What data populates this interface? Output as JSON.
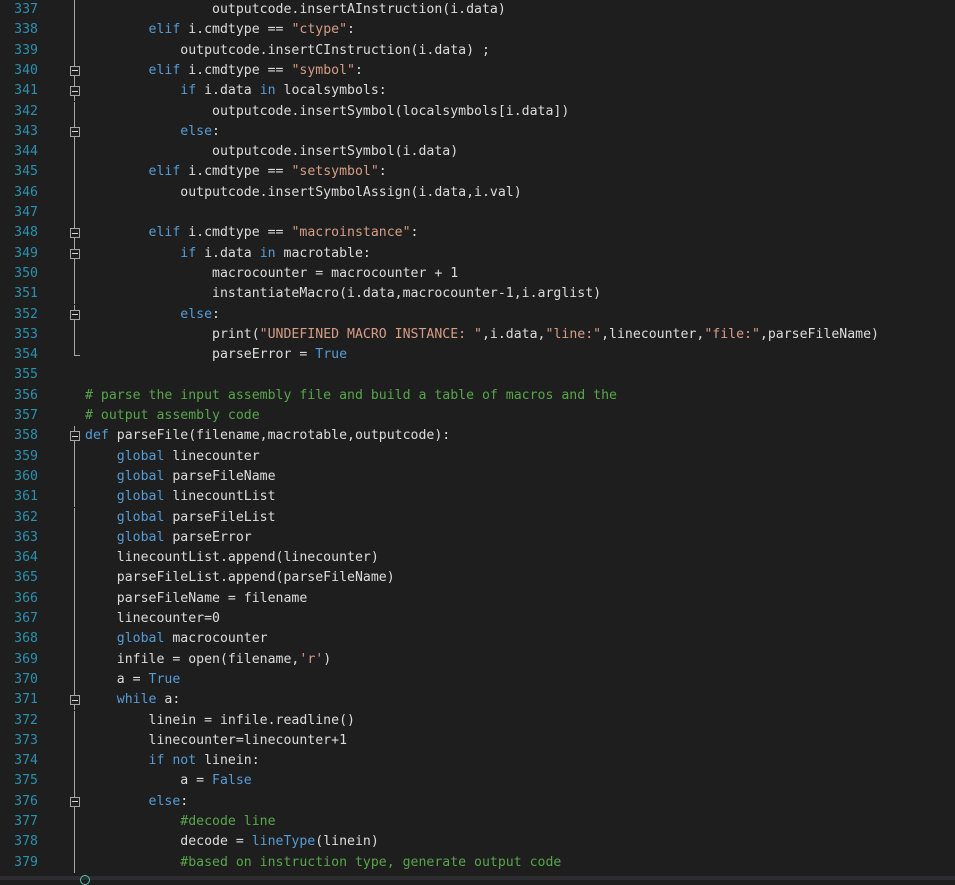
{
  "editor": {
    "colors": {
      "background": "#1e1e1e",
      "line_number": "#2b91af",
      "keyword": "#569cd6",
      "string": "#d69d85",
      "comment": "#57a64a",
      "default": "#dcdcdc"
    },
    "lines": [
      {
        "n": "337",
        "segs": [
          [
            "",
            "                outputcode.insertAInstruction(i.data)"
          ]
        ]
      },
      {
        "n": "338",
        "segs": [
          [
            "kw",
            "        elif"
          ],
          [
            "",
            " i.cmdtype == "
          ],
          [
            "str",
            "\"ctype\""
          ],
          [
            "",
            ":"
          ]
        ]
      },
      {
        "n": "339",
        "segs": [
          [
            "",
            "            outputcode.insertCInstruction(i.data) ;"
          ]
        ]
      },
      {
        "n": "340",
        "segs": [
          [
            "kw",
            "        elif"
          ],
          [
            "",
            " i.cmdtype == "
          ],
          [
            "str",
            "\"symbol\""
          ],
          [
            "",
            ":"
          ]
        ]
      },
      {
        "n": "341",
        "segs": [
          [
            "kw",
            "            if"
          ],
          [
            "",
            " i.data "
          ],
          [
            "kw",
            "in"
          ],
          [
            "",
            " localsymbols:"
          ]
        ]
      },
      {
        "n": "342",
        "segs": [
          [
            "",
            "                outputcode.insertSymbol(localsymbols[i.data])"
          ]
        ]
      },
      {
        "n": "343",
        "segs": [
          [
            "kw",
            "            else"
          ],
          [
            "",
            ":"
          ]
        ]
      },
      {
        "n": "344",
        "segs": [
          [
            "",
            "                outputcode.insertSymbol(i.data)"
          ]
        ]
      },
      {
        "n": "345",
        "segs": [
          [
            "kw",
            "        elif"
          ],
          [
            "",
            " i.cmdtype == "
          ],
          [
            "str",
            "\"setsymbol\""
          ],
          [
            "",
            ":"
          ]
        ]
      },
      {
        "n": "346",
        "segs": [
          [
            "",
            "            outputcode.insertSymbolAssign(i.data,i.val)"
          ]
        ]
      },
      {
        "n": "347",
        "segs": []
      },
      {
        "n": "348",
        "segs": [
          [
            "kw",
            "        elif"
          ],
          [
            "",
            " i.cmdtype == "
          ],
          [
            "str",
            "\"macroinstance\""
          ],
          [
            "",
            ":"
          ]
        ]
      },
      {
        "n": "349",
        "segs": [
          [
            "kw",
            "            if"
          ],
          [
            "",
            " i.data "
          ],
          [
            "kw",
            "in"
          ],
          [
            "",
            " macrotable:"
          ]
        ]
      },
      {
        "n": "350",
        "segs": [
          [
            "",
            "                macrocounter = macrocounter + 1"
          ]
        ]
      },
      {
        "n": "351",
        "segs": [
          [
            "",
            "                instantiateMacro(i.data,macrocounter-1,i.arglist)"
          ]
        ]
      },
      {
        "n": "352",
        "segs": [
          [
            "kw",
            "            else"
          ],
          [
            "",
            ":"
          ]
        ]
      },
      {
        "n": "353",
        "segs": [
          [
            "",
            "                print("
          ],
          [
            "str",
            "\"UNDEFINED MACRO INSTANCE: \""
          ],
          [
            "",
            ",i.data,"
          ],
          [
            "str",
            "\"line:\""
          ],
          [
            "",
            ",linecounter,"
          ],
          [
            "str",
            "\"file:\""
          ],
          [
            "",
            ",parseFileName)"
          ]
        ]
      },
      {
        "n": "354",
        "segs": [
          [
            "",
            "                parseError = "
          ],
          [
            "kw",
            "True"
          ]
        ]
      },
      {
        "n": "355",
        "segs": []
      },
      {
        "n": "356",
        "segs": [
          [
            "cm",
            "# parse the input assembly file and build a table of macros and the"
          ]
        ]
      },
      {
        "n": "357",
        "segs": [
          [
            "cm",
            "# output assembly code"
          ]
        ]
      },
      {
        "n": "358",
        "segs": [
          [
            "kw",
            "def"
          ],
          [
            "",
            " parseFile(filename,macrotable,outputcode):"
          ]
        ]
      },
      {
        "n": "359",
        "segs": [
          [
            "kw",
            "    global"
          ],
          [
            "",
            " linecounter"
          ]
        ]
      },
      {
        "n": "360",
        "segs": [
          [
            "kw",
            "    global"
          ],
          [
            "",
            " parseFileName"
          ]
        ]
      },
      {
        "n": "361",
        "segs": [
          [
            "kw",
            "    global"
          ],
          [
            "",
            " linecountList"
          ]
        ]
      },
      {
        "n": "362",
        "segs": [
          [
            "kw",
            "    global"
          ],
          [
            "",
            " parseFileList"
          ]
        ]
      },
      {
        "n": "363",
        "segs": [
          [
            "kw",
            "    global"
          ],
          [
            "",
            " parseError"
          ]
        ]
      },
      {
        "n": "364",
        "segs": [
          [
            "",
            "    linecountList.append(linecounter)"
          ]
        ]
      },
      {
        "n": "365",
        "segs": [
          [
            "",
            "    parseFileList.append(parseFileName)"
          ]
        ]
      },
      {
        "n": "366",
        "segs": [
          [
            "",
            "    parseFileName = filename"
          ]
        ]
      },
      {
        "n": "367",
        "segs": [
          [
            "",
            "    linecounter=0"
          ]
        ]
      },
      {
        "n": "368",
        "segs": [
          [
            "kw",
            "    global"
          ],
          [
            "",
            " macrocounter"
          ]
        ]
      },
      {
        "n": "369",
        "segs": [
          [
            "",
            "    infile = open(filename,"
          ],
          [
            "str",
            "'r'"
          ],
          [
            "",
            ")"
          ]
        ]
      },
      {
        "n": "370",
        "segs": [
          [
            "",
            "    a = "
          ],
          [
            "kw",
            "True"
          ]
        ]
      },
      {
        "n": "371",
        "segs": [
          [
            "kw",
            "    while"
          ],
          [
            "",
            " a:"
          ]
        ]
      },
      {
        "n": "372",
        "segs": [
          [
            "",
            "        linein = infile.readline()"
          ]
        ]
      },
      {
        "n": "373",
        "segs": [
          [
            "",
            "        linecounter=linecounter+1"
          ]
        ]
      },
      {
        "n": "374",
        "segs": [
          [
            "kw",
            "        if not"
          ],
          [
            "",
            " linein:"
          ]
        ]
      },
      {
        "n": "375",
        "segs": [
          [
            "",
            "            a = "
          ],
          [
            "kw",
            "False"
          ]
        ]
      },
      {
        "n": "376",
        "segs": [
          [
            "kw",
            "        else"
          ],
          [
            "",
            ":"
          ]
        ]
      },
      {
        "n": "377",
        "segs": [
          [
            "cm",
            "            #decode line"
          ]
        ]
      },
      {
        "n": "378",
        "segs": [
          [
            "",
            "            decode = "
          ],
          [
            "kw",
            "lineType"
          ],
          [
            "",
            "(linein)"
          ]
        ]
      },
      {
        "n": "379",
        "segs": [
          [
            "cm",
            "            #based on instruction type, generate output code"
          ]
        ]
      }
    ]
  }
}
